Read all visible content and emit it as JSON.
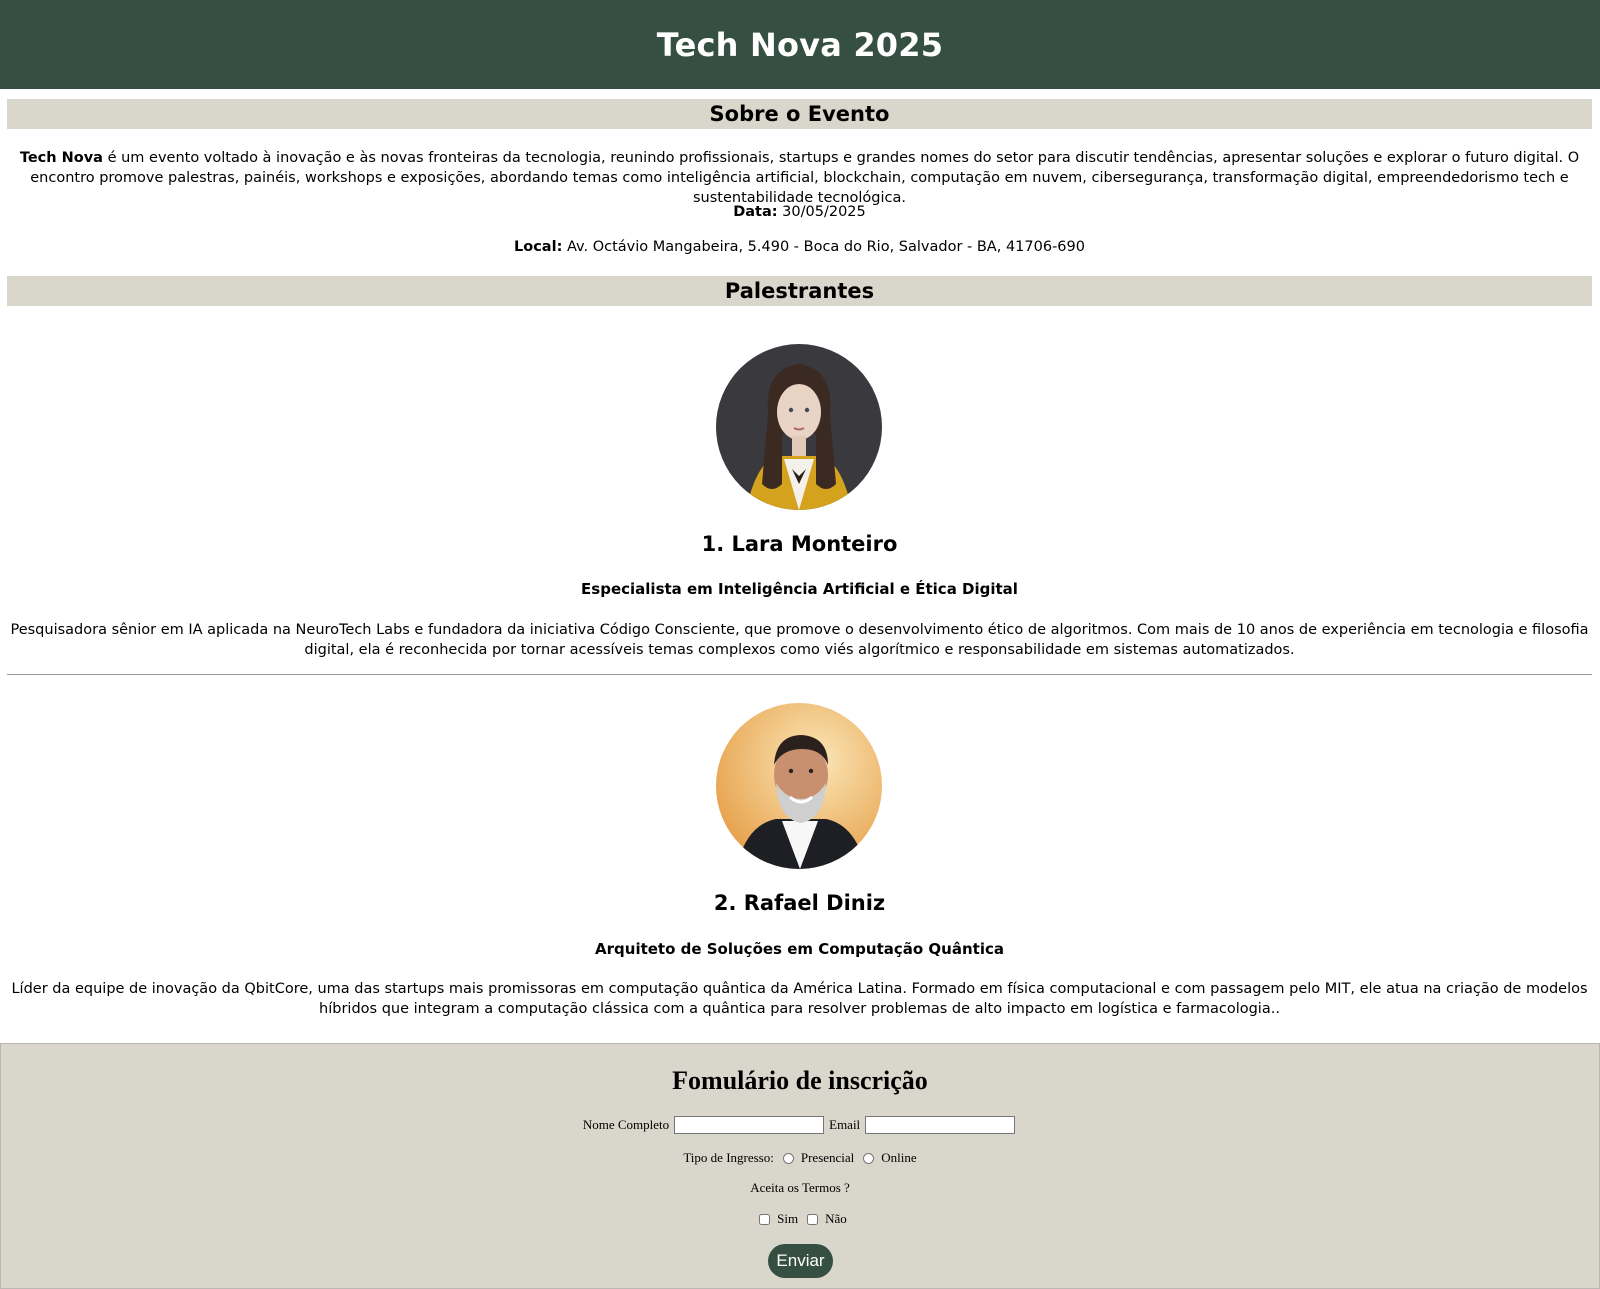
{
  "header": {
    "title": "Tech Nova 2025"
  },
  "about": {
    "heading": "Sobre o Evento",
    "brand": "Tech Nova",
    "description": " é um evento voltado à inovação e às novas fronteiras da tecnologia, reunindo profissionais, startups e grandes nomes do setor para discutir tendências, apresentar soluções e explorar o futuro digital. O encontro promove palestras, painéis, workshops e exposições, abordando temas como inteligência artificial, blockchain, computação em nuvem, cibersegurança, transformação digital, empreendedorismo tech e sustentabilidade tecnológica.",
    "date_label": "Data:",
    "date_value": " 30/05/2025",
    "location_label": "Local:",
    "location_value": " Av. Octávio Mangabeira, 5.490 - Boca do Rio, Salvador - BA, 41706-690"
  },
  "speakers": {
    "heading": "Palestrantes",
    "items": [
      {
        "name": "1. Lara Monteiro",
        "role": "Especialista em Inteligência Artificial e Ética Digital",
        "bio": "Pesquisadora sênior em IA aplicada na NeuroTech Labs e fundadora da iniciativa Código Consciente, que promove o desenvolvimento ético de algoritmos. Com mais de 10 anos de experiência em tecnologia e filosofia digital, ela é reconhecida por tornar acessíveis temas complexos como viés algorítmico e responsabilidade em sistemas automatizados."
      },
      {
        "name": "2. Rafael Diniz",
        "role": "Arquiteto de Soluções em Computação Quântica",
        "bio": "Líder da equipe de inovação da QbitCore, uma das startups mais promissoras em computação quântica da América Latina. Formado em física computacional e com passagem pelo MIT, ele atua na criação de modelos híbridos que integram a computação clássica com a quântica para resolver problemas de alto impacto em logística e farmacologia.."
      }
    ]
  },
  "form": {
    "title": "Fomulário de inscrição",
    "name_label": "Nome Completo",
    "name_value": "",
    "email_label": "Email",
    "email_value": "",
    "ticket_label": "Tipo de Ingresso:",
    "ticket_options": [
      "Presencial",
      "Online"
    ],
    "terms_label": "Aceita os Termos ?",
    "terms_options": [
      "Sim",
      "Não"
    ],
    "submit_label": "Enviar"
  },
  "colors": {
    "header_bg": "#354f43",
    "section_bg": "#d9d7cb",
    "button_bg": "#354f43"
  }
}
